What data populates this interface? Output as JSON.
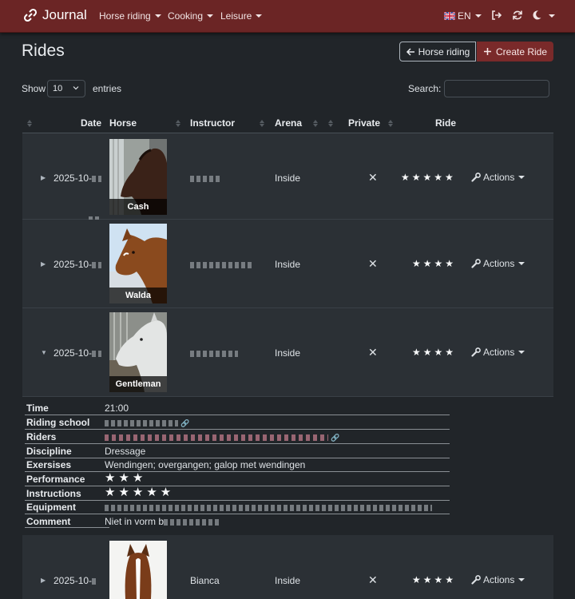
{
  "navbar": {
    "brand": "Journal",
    "menus": [
      "Horse riding",
      "Cooking",
      "Leisure"
    ],
    "language": "EN"
  },
  "page": {
    "title": "Rides",
    "back_button": "Horse riding",
    "create_button": "Create Ride"
  },
  "controls": {
    "show_label": "Show",
    "entries_value": "10",
    "entries_label": "entries",
    "search_label": "Search:"
  },
  "table": {
    "headers": [
      "Date",
      "Horse",
      "Instructor",
      "Arena",
      "Private",
      "Ride"
    ],
    "rows": [
      {
        "date": "2025-10-",
        "horse": "Cash",
        "instructor": "",
        "arena": "Inside",
        "private": "✕",
        "stars": "★★★★★",
        "actions": "Actions"
      },
      {
        "date": "2025-10-",
        "horse": "Walda",
        "instructor": "",
        "arena": "Inside",
        "private": "✕",
        "stars": "★★★★",
        "actions": "Actions"
      },
      {
        "date": "2025-10-",
        "horse": "Gentleman",
        "instructor": "",
        "arena": "Inside",
        "private": "✕",
        "stars": "★★★★",
        "actions": "Actions"
      },
      {
        "date": "2025-10-",
        "horse": "",
        "instructor": "Bianca",
        "arena": "Inside",
        "private": "✕",
        "stars": "★★★★",
        "actions": "Actions"
      }
    ]
  },
  "details": {
    "labels": [
      "Time",
      "Riding school",
      "Riders",
      "Discipline",
      "Exersises",
      "Performance",
      "Instructions",
      "Equipment",
      "Comment"
    ],
    "time": "21:00",
    "discipline": "Dressage",
    "exercises": "Wendingen; overgangen; galop met wendingen",
    "performance": "★★★",
    "instructions": "★★★★★",
    "comment_prefix": "Niet in vorm b"
  },
  "colors": {
    "navbar": "#6b2525",
    "background": "#212529",
    "row": "#2b3035",
    "create_button": "#7a2a2a"
  }
}
